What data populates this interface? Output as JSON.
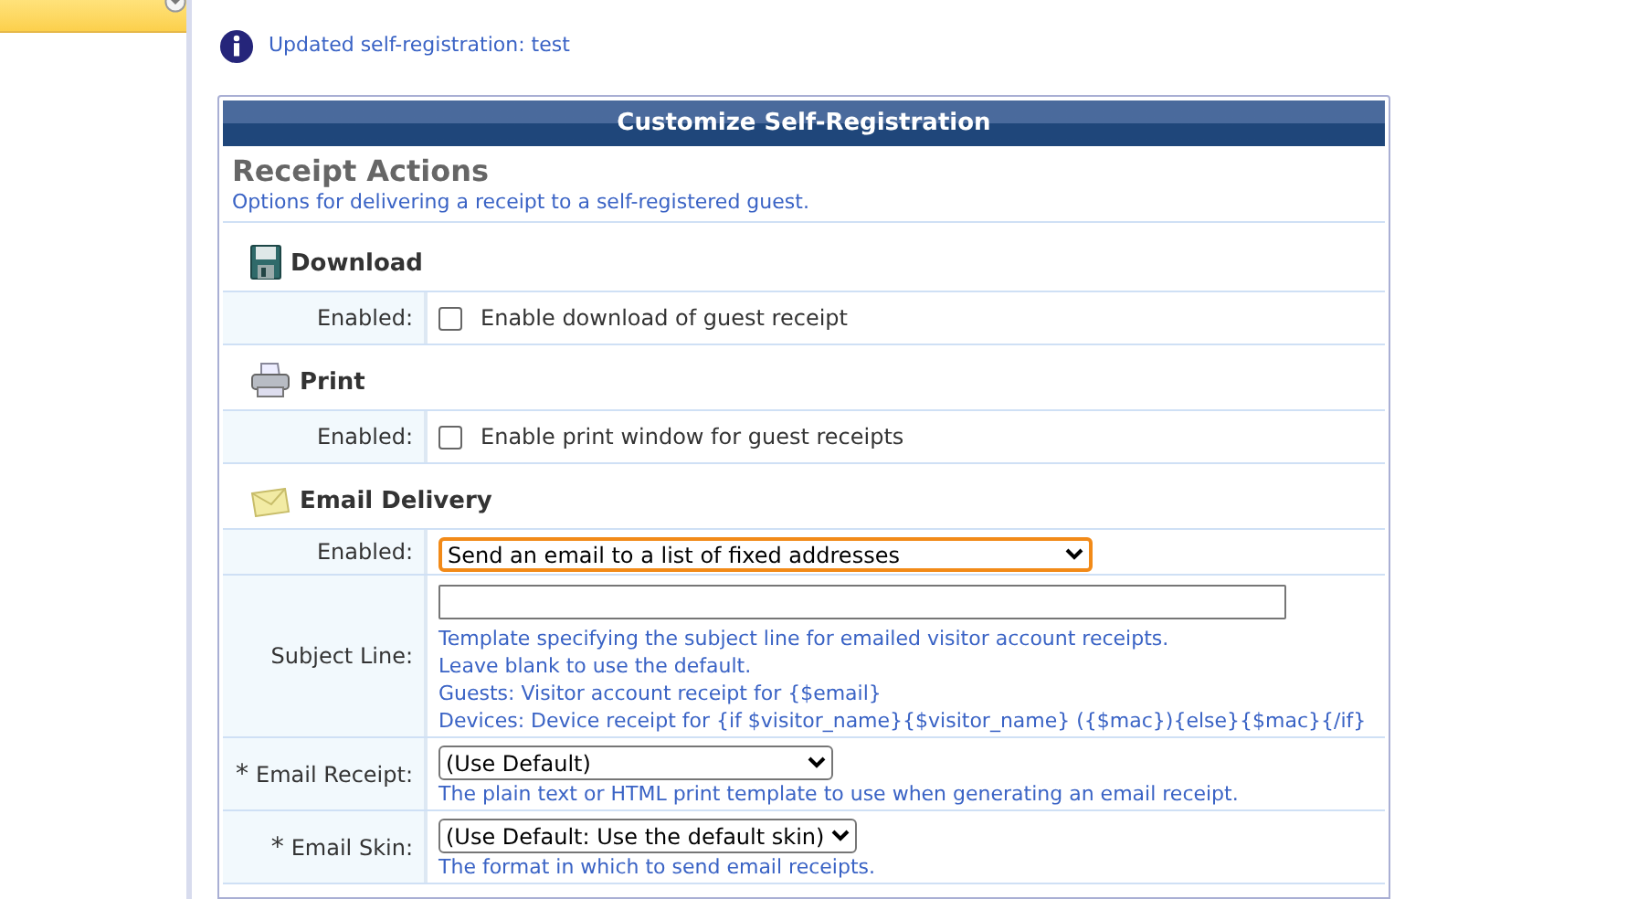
{
  "notice": {
    "text": "Updated self-registration: test"
  },
  "panel": {
    "title": "Customize Self-Registration",
    "section_title": "Receipt Actions",
    "section_description": "Options for delivering a receipt to a self-registered guest.",
    "groups": [
      {
        "kind": "download",
        "heading": "Download",
        "fields": [
          {
            "kind": "checkbox",
            "label": "Enabled:",
            "checked": false,
            "text": "Enable download of guest receipt"
          }
        ]
      },
      {
        "kind": "print",
        "heading": "Print",
        "fields": [
          {
            "kind": "checkbox",
            "label": "Enabled:",
            "checked": false,
            "text": "Enable print window for guest receipts"
          }
        ]
      },
      {
        "kind": "email",
        "heading": "Email Delivery",
        "fields": [
          {
            "kind": "select",
            "label": "Enabled:",
            "focused": true,
            "value": "Send an email to a list of fixed addresses"
          },
          {
            "kind": "text",
            "label": "Subject Line:",
            "hints": [
              "Template specifying the subject line for emailed visitor account receipts.",
              "Leave blank to use the default.",
              "Guests: Visitor account receipt for {$email}",
              "Devices: Device receipt for {if $visitor_name}{$visitor_name} ({$mac}){else}{$mac}{/if}"
            ]
          },
          {
            "kind": "select",
            "label": "Email Receipt:",
            "marker": "*",
            "focused": false,
            "value": "(Use Default)",
            "hints": [
              "The plain text or HTML print template to use when generating an email receipt."
            ]
          },
          {
            "kind": "select",
            "label": "Email Skin:",
            "marker": "*",
            "focused": false,
            "value": "(Use Default: Use the default skin)",
            "hints": [
              "The format in which to send email receipts."
            ]
          }
        ]
      }
    ]
  }
}
